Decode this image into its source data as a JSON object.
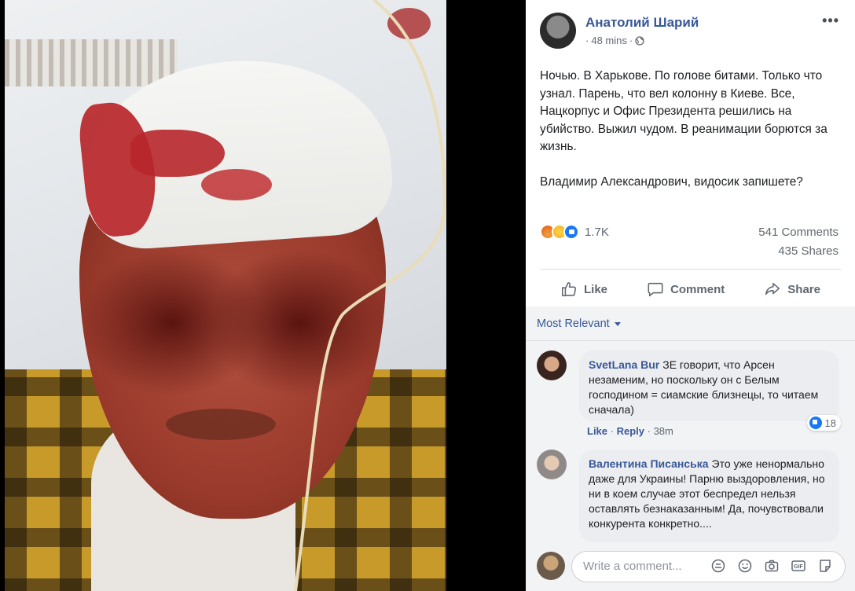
{
  "post": {
    "author": "Анатолий Шарий",
    "time": "48 mins",
    "paragraphs": [
      "Ночью. В Харькове. По голове битами. Только что узнал. Парень, что вел колонну в Киеве. Все, Нацкорпус и Офис Президента решились на убийство. Выжил чудом. В реанимации борются за жизнь.",
      "Владимир Александрович, видосик запишете?"
    ],
    "reaction_count": "1.7K",
    "comments_count": "541 Comments",
    "shares_count": "435 Shares"
  },
  "actions": {
    "like": "Like",
    "comment": "Comment",
    "share": "Share"
  },
  "comments": {
    "sort_label": "Most Relevant",
    "items": [
      {
        "author": "SvetLana Bur",
        "text": "ЗЕ говорит, что Арсен незаменим, но поскольку он с Белым господином = сиамские близнецы, то читаем сначала)",
        "like_label": "Like",
        "reply_label": "Reply",
        "time": "38m",
        "likes": "18"
      },
      {
        "author": "Валентина Писанська",
        "text": "Это уже ненормально даже для Украины! Парню выздоровления, но ни в коем случае этот беспредел нельзя оставлять безнаказанным! Да, почувствовали конкурента конкретно...."
      }
    ],
    "composer_placeholder": "Write a comment..."
  },
  "colors": {
    "link_blue": "#385898",
    "like_blue": "#1877f2",
    "comment_bg": "#f2f3f5",
    "bubble_bg": "#ebedf0"
  },
  "icons": {
    "more": "more-horizontal-icon",
    "privacy": "globe-icon",
    "like": "thumbs-up-icon",
    "comment": "speech-bubble-icon",
    "share": "share-arrow-icon",
    "composer": [
      "sticker-icon",
      "emoji-icon",
      "camera-icon",
      "gif-icon",
      "sticker-peel-icon"
    ]
  }
}
